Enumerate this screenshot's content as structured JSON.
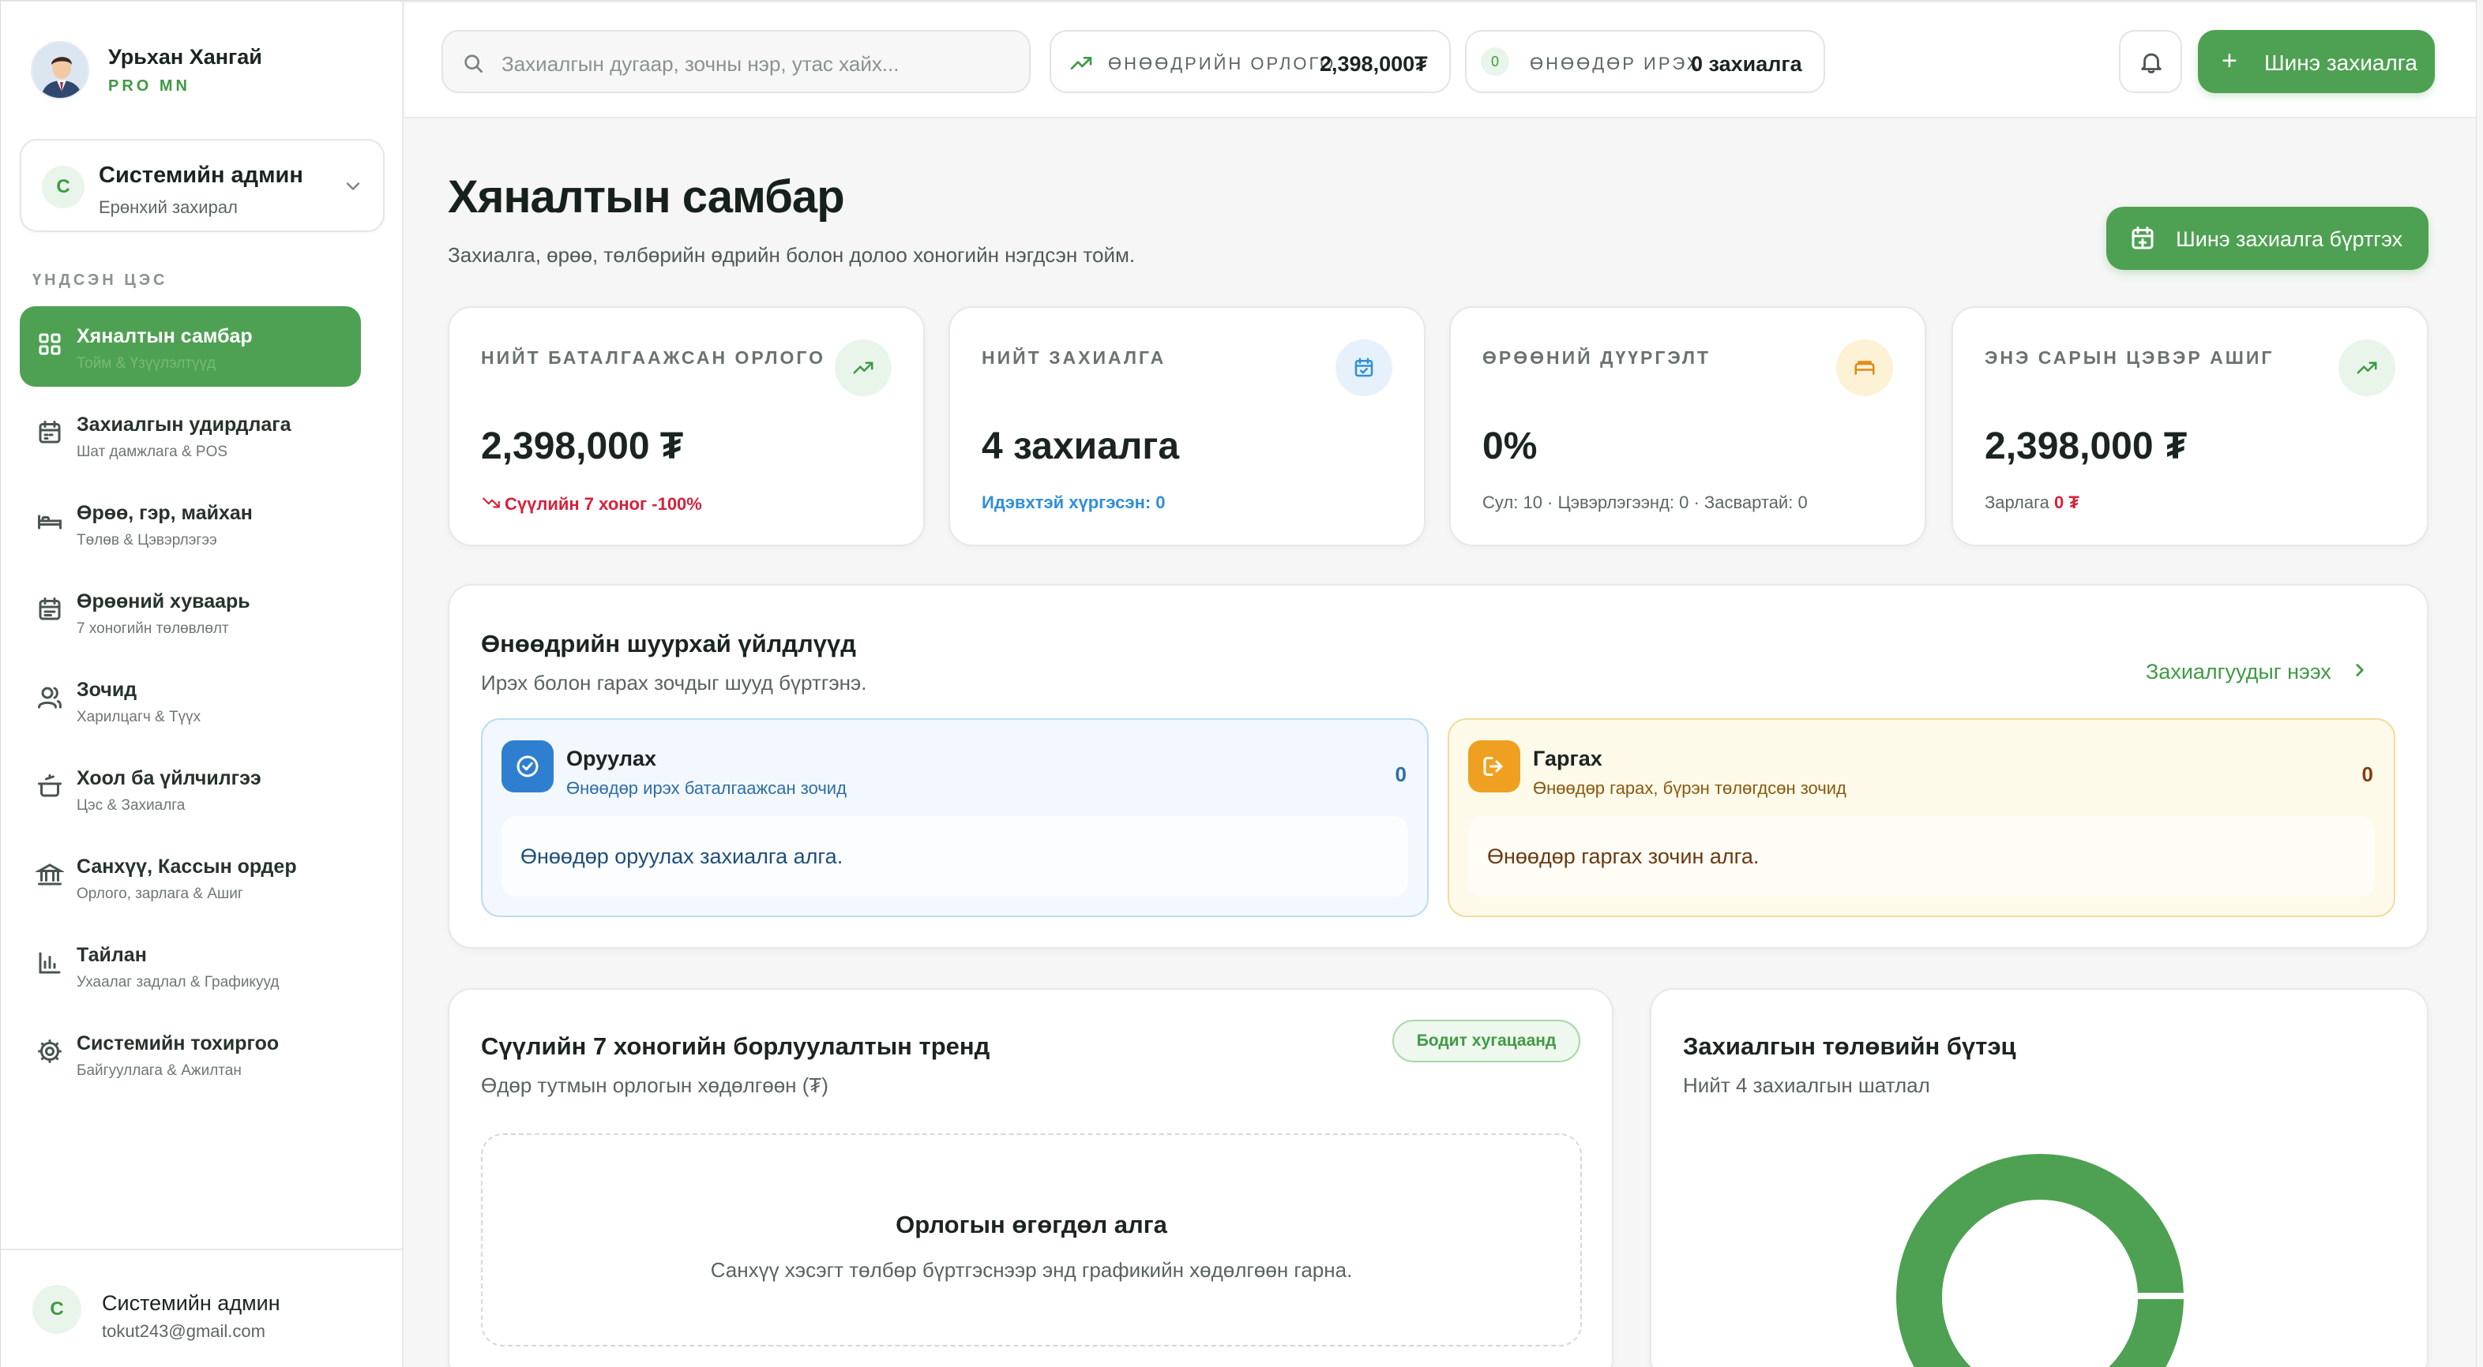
{
  "user": {
    "name": "Урьхан Хангай",
    "tag": "PRO MN"
  },
  "role": {
    "initial": "С",
    "title": "Системийн админ",
    "subtitle": "Ерөнхий захирал"
  },
  "sidebar": {
    "heading": "ҮНДСЭН ЦЭС",
    "items": [
      {
        "label": "Хяналтын самбар",
        "sub": "Тойм & Үзүүлэлтүүд",
        "icon": "grid-icon"
      },
      {
        "label": "Захиалгын удирдлага",
        "sub": "Шат дамжлага & POS",
        "icon": "calendar-icon"
      },
      {
        "label": "Өрөө, гэр, майхан",
        "sub": "Төлөв & Цэвэрлэгээ",
        "icon": "bed-icon"
      },
      {
        "label": "Өрөөний хуваарь",
        "sub": "7 хоногийн төлөвлөлт",
        "icon": "schedule-icon"
      },
      {
        "label": "Зочид",
        "sub": "Харилцагч & Түүх",
        "icon": "users-icon"
      },
      {
        "label": "Хоол ба үйлчилгээ",
        "sub": "Цэс & Захиалга",
        "icon": "cooking-pot-icon"
      },
      {
        "label": "Санхүү, Кассын ордер",
        "sub": "Орлого, зарлага & Ашиг",
        "icon": "bank-icon"
      },
      {
        "label": "Тайлан",
        "sub": "Ухаалаг задлал & Графикууд",
        "icon": "bar-chart-icon"
      },
      {
        "label": "Системийн тохиргоо",
        "sub": "Байгууллага & Ажилтан",
        "icon": "gear-icon"
      }
    ],
    "footer": {
      "initial": "С",
      "name": "Системийн админ",
      "email": "tokut243@gmail.com"
    }
  },
  "topbar": {
    "search_placeholder": "Захиалгын дугаар, зочны нэр, утас хайх...",
    "income_label": "ӨНӨӨДРИЙН ОРЛОГО",
    "income_value": "2,398,000₮",
    "arrivals_count": "0",
    "arrivals_label": "ӨНӨӨДӨР ИРЭХ",
    "arrivals_value": "0 захиалга",
    "new_booking": "Шинэ захиалга"
  },
  "page": {
    "title": "Хяналтын самбар",
    "subtitle": "Захиалга, өрөө, төлбөрийн өдрийн болон долоо хоногийн нэгдсэн тойм.",
    "register_button": "Шинэ захиалга бүртгэх"
  },
  "stats": [
    {
      "label": "НИЙТ БАТАЛГААЖСАН ОРЛОГО",
      "value": "2,398,000 ₮",
      "foot": "Сүүлийн 7 хоног -100%",
      "icon": "trending-up-icon"
    },
    {
      "label": "НИЙТ ЗАХИАЛГА",
      "value": "4 захиалга",
      "foot": "Идэвхтэй хүргэсэн: 0",
      "icon": "calendar-check-icon"
    },
    {
      "label": "ӨРӨӨНИЙ ДҮҮРГЭЛТ",
      "value": "0%",
      "foot": "Сул: 10 · Цэвэрлэгээнд: 0 · Засвартай: 0",
      "icon": "bed-icon"
    },
    {
      "label": "ЭНЭ САРЫН ЦЭВЭР АШИГ",
      "value": "2,398,000 ₮",
      "foot_prefix": "Зарлага",
      "foot_value": "0 ₮",
      "icon": "trending-up-icon"
    }
  ],
  "quick": {
    "title": "Өнөөдрийн шуурхай үйлдлүүд",
    "subtitle": "Ирэх болон гарах зочдыг шууд бүртгэнэ.",
    "link": "Захиалгуудыг нээх",
    "checkin": {
      "title": "Оруулах",
      "sub": "Өнөөдөр ирэх баталгаажсан зочид",
      "count": "0",
      "empty": "Өнөөдөр оруулах захиалга алга."
    },
    "checkout": {
      "title": "Гаргах",
      "sub": "Өнөөдөр гарах, бүрэн төлөгдсөн зочид",
      "count": "0",
      "empty": "Өнөөдөр гаргах зочин алга."
    }
  },
  "trend": {
    "title": "Сүүлийн 7 хоногийн борлуулалтын тренд",
    "subtitle": "Өдөр тутмын орлогын хөдөлгөөн (₮)",
    "badge": "Бодит хугацаанд",
    "empty_title": "Орлогын өгөгдөл алга",
    "empty_sub": "Санхүү хэсэгт төлбөр бүртгэснээр энд графикийн хөдөлгөөн гарна."
  },
  "status": {
    "title": "Захиалгын төлөвийн бүтэц",
    "subtitle": "Нийт 4 захиалгын шатлал"
  },
  "colors": {
    "accent": "#4ea152",
    "danger": "#d6213b",
    "info": "#2f8fd8",
    "warning": "#f0a020"
  }
}
